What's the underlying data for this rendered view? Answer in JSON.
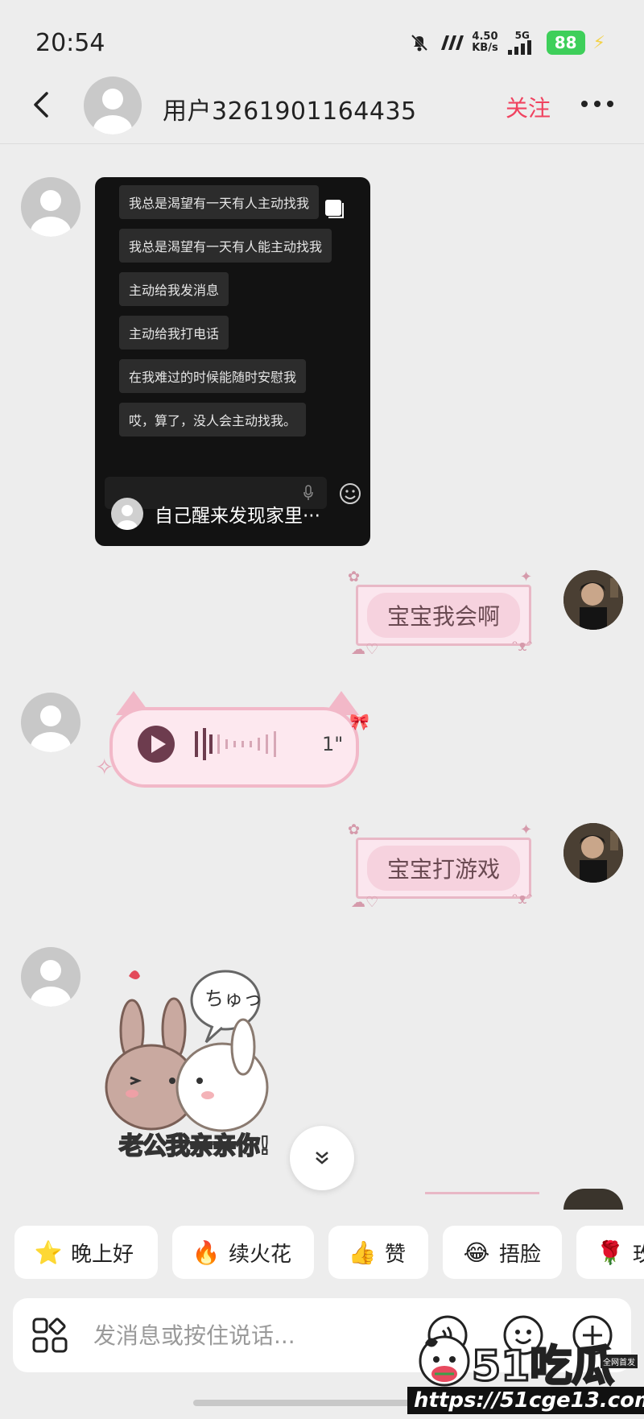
{
  "status_bar": {
    "time": "20:54",
    "net_speed_value": "4.50",
    "net_speed_unit": "KB/s",
    "signal": "5G",
    "battery": "88"
  },
  "header": {
    "contact_name": "用户3261901164435",
    "follow_label": "关注"
  },
  "messages": {
    "screenshot": {
      "lines": [
        "我总是渴望有一天有人主动找我",
        "我总是渴望有一天有人能主动找我",
        "主动给我发消息",
        "主动给我打电话",
        "在我难过的时候能随时安慰我",
        "哎，算了，没人会主动找我。"
      ],
      "caption": "自己醒来发现家里···"
    },
    "reply1": "宝宝我会啊",
    "voice_duration": "1\"",
    "reply2": "宝宝打游戏",
    "sticker_bubble": "ちゅっ",
    "sticker_caption": "老公我亲亲你!"
  },
  "quick_replies": [
    {
      "icon": "star-face-icon",
      "glyph": "⭐",
      "label": "晚上好"
    },
    {
      "icon": "fire-icon",
      "glyph": "🔥",
      "label": "续火花"
    },
    {
      "icon": "thumbs-up-icon",
      "glyph": "👍",
      "label": "赞"
    },
    {
      "icon": "facepalm-icon",
      "glyph": "😂",
      "label": "捂脸"
    },
    {
      "icon": "rose-icon",
      "glyph": "🌹",
      "label": "玫"
    }
  ],
  "input": {
    "placeholder": "发消息或按住说话..."
  },
  "watermark": {
    "logo": "51吃瓜",
    "tag": "全网首发",
    "url": "https://51cge13.com"
  },
  "colors": {
    "accent": "#f04360",
    "background": "#ededed",
    "bubble_pink": "#fbe6ee"
  }
}
